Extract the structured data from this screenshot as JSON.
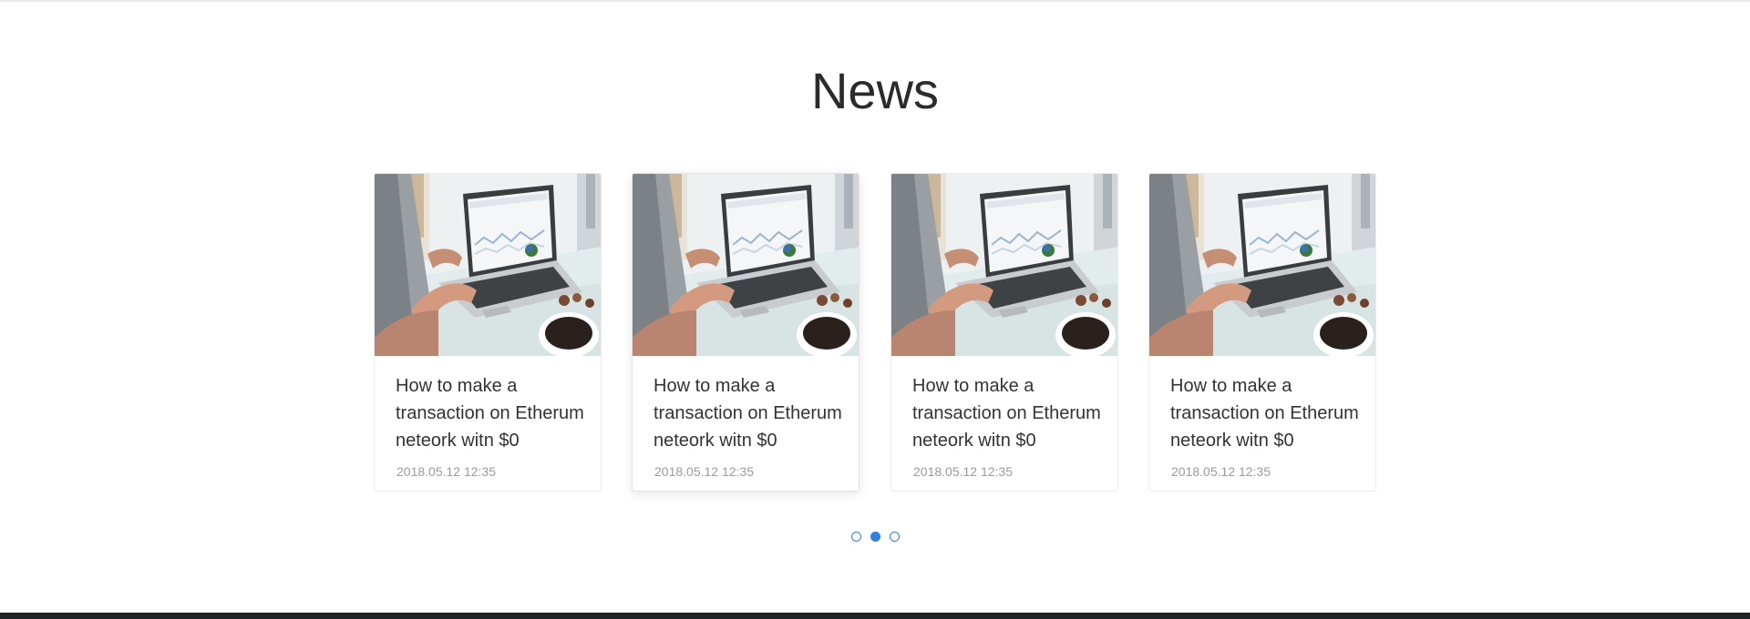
{
  "section": {
    "title": "News"
  },
  "cards": [
    {
      "title": "How to make a transaction on Etherum neteork witn $0",
      "date": "2018.05.12 12:35",
      "image_icon": "laptop-photo-icon"
    },
    {
      "title": "How to make a transaction on Etherum neteork witn $0",
      "date": "2018.05.12 12:35",
      "image_icon": "laptop-photo-icon"
    },
    {
      "title": "How to make a transaction on Etherum neteork witn $0",
      "date": "2018.05.12 12:35",
      "image_icon": "laptop-photo-icon"
    },
    {
      "title": "How to make a transaction on Etherum neteork witn $0",
      "date": "2018.05.12 12:35",
      "image_icon": "laptop-photo-icon"
    }
  ],
  "pagination": {
    "pages": 3,
    "active": 2
  },
  "colors": {
    "accent": "#2f7fe0",
    "title_text": "#2b2b2b",
    "date_text": "#9b9b9b",
    "footer": "#1f2226"
  }
}
